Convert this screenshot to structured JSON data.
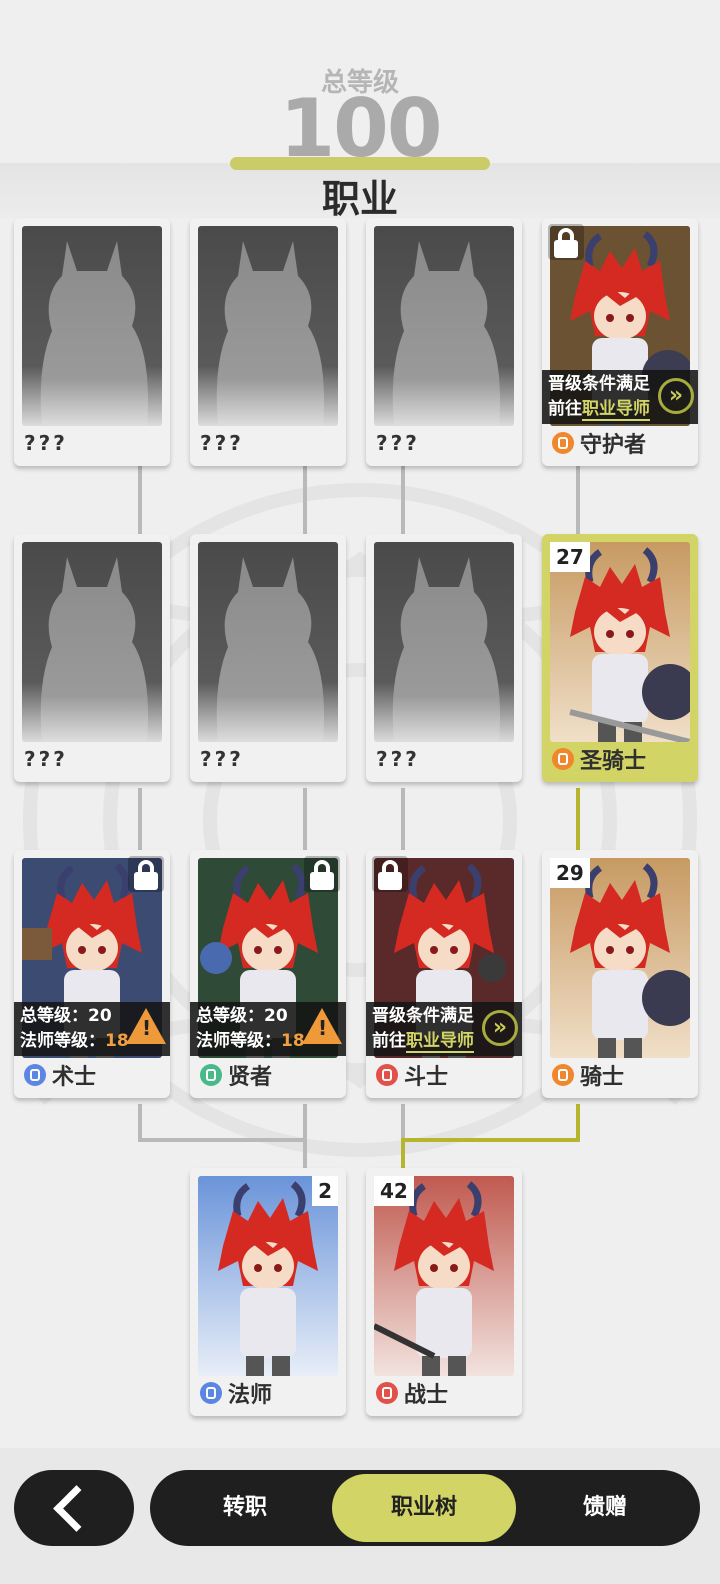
{
  "header": {
    "total_level_label": "总等级",
    "total_level_value": "100",
    "title": "职业"
  },
  "colors": {
    "accent": "#d3d466",
    "dark": "#1f1f1f",
    "warning": "#ef9a3a"
  },
  "tree": {
    "row1": [
      {
        "name": "???",
        "state": "unknown"
      },
      {
        "name": "???",
        "state": "unknown"
      },
      {
        "name": "???",
        "state": "unknown"
      },
      {
        "name": "守护者",
        "state": "locked",
        "icon": "guardian-icon",
        "icon_color": "#f0872c",
        "notice": {
          "line1": "晋级条件满足",
          "line2_prefix": "前往",
          "line2_link": "职业导师"
        }
      }
    ],
    "row2": [
      {
        "name": "???",
        "state": "unknown"
      },
      {
        "name": "???",
        "state": "unknown"
      },
      {
        "name": "???",
        "state": "unknown"
      },
      {
        "name": "圣骑士",
        "state": "active",
        "level": "27",
        "icon": "paladin-icon",
        "icon_color": "#f0872c"
      }
    ],
    "row3": [
      {
        "name": "术士",
        "state": "locked",
        "icon": "warlock-icon",
        "icon_color": "#5b86e3",
        "requirements": {
          "total_label": "总等级：",
          "total_value": "20",
          "mage_label": "法师等级：",
          "mage_value": "18"
        }
      },
      {
        "name": "贤者",
        "state": "locked",
        "icon": "sage-icon",
        "icon_color": "#4ab98a",
        "requirements": {
          "total_label": "总等级：",
          "total_value": "20",
          "mage_label": "法师等级：",
          "mage_value": "18"
        }
      },
      {
        "name": "斗士",
        "state": "locked",
        "icon": "brawler-icon",
        "icon_color": "#e2504a",
        "notice": {
          "line1": "晋级条件满足",
          "line2_prefix": "前往",
          "line2_link": "职业导师"
        }
      },
      {
        "name": "骑士",
        "state": "unlocked",
        "level": "29",
        "icon": "knight-icon",
        "icon_color": "#f0872c"
      }
    ],
    "row4": [
      {
        "name": "法师",
        "state": "unlocked",
        "level": "2",
        "icon": "mage-icon",
        "icon_color": "#5b86e3"
      },
      {
        "name": "战士",
        "state": "unlocked",
        "level": "42",
        "icon": "warrior-icon",
        "icon_color": "#e2504a"
      }
    ]
  },
  "nav": {
    "back": "back",
    "tabs": [
      "转职",
      "职业树",
      "馈赠"
    ],
    "active_tab": "职业树"
  }
}
